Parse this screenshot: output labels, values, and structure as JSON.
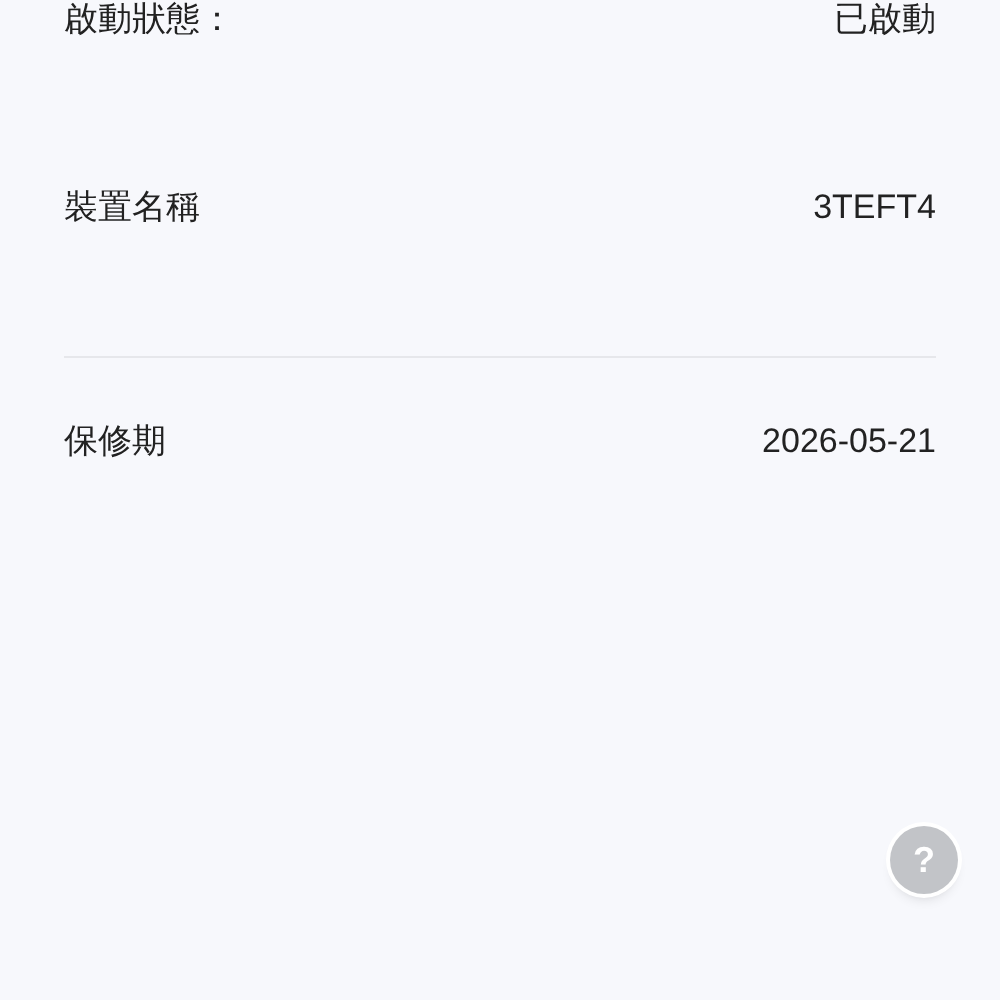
{
  "rows": [
    {
      "label": "啟動狀態：",
      "value": "已啟動",
      "divider_after": false
    },
    {
      "label": "裝置名稱",
      "value": "3TEFT4",
      "divider_after": true
    },
    {
      "label": "保修期",
      "value": "2026-05-21",
      "divider_after": false
    }
  ],
  "help_button": {
    "label": "?"
  }
}
